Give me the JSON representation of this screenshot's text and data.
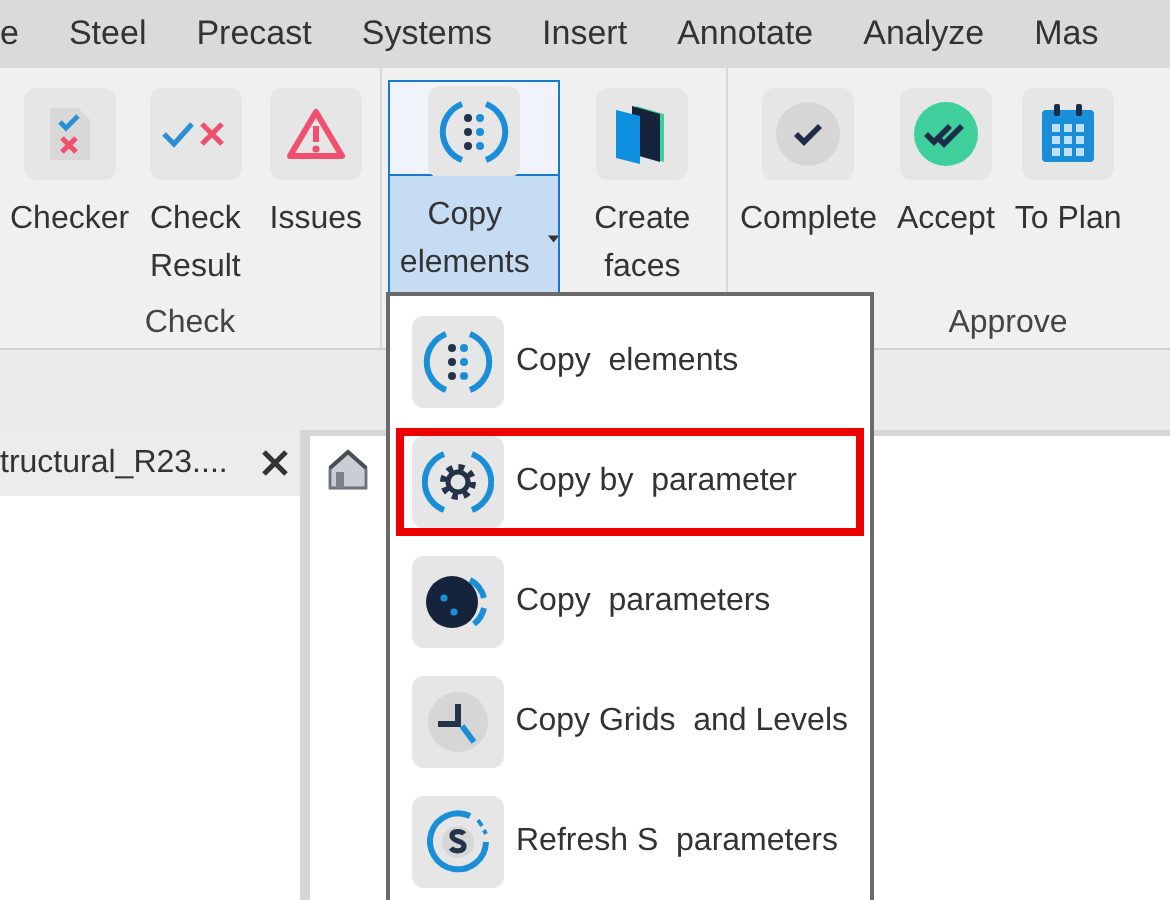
{
  "menu_tabs": [
    "e",
    "Steel",
    "Precast",
    "Systems",
    "Insert",
    "Annotate",
    "Analyze",
    "Mas"
  ],
  "ribbon": {
    "groups": [
      {
        "label": "Check",
        "buttons": [
          {
            "label": "Checker",
            "kind": "checker"
          },
          {
            "label": "Check Result",
            "kind": "check-result"
          },
          {
            "label": "Issues",
            "kind": "issues"
          }
        ]
      },
      {
        "buttons": [
          {
            "label": "Copy elements",
            "kind": "copy-split",
            "expanded": true
          },
          {
            "label": "Create faces",
            "kind": "faces"
          }
        ]
      },
      {
        "label": "Approve",
        "buttons": [
          {
            "label": "Complete",
            "kind": "complete"
          },
          {
            "label": "Accept",
            "kind": "accept"
          },
          {
            "label": "To Plan",
            "kind": "plan"
          }
        ]
      }
    ]
  },
  "panel": {
    "tab_title": "tructural_R23...."
  },
  "dropdown": {
    "items": [
      {
        "label": "Copy  elements",
        "kind": "copy",
        "selected": false
      },
      {
        "label": "Copy by  parameter",
        "kind": "gear",
        "selected": true
      },
      {
        "label": "Copy  parameters",
        "kind": "params",
        "selected": false
      },
      {
        "label": "Copy Grids  and Levels",
        "kind": "grids",
        "selected": false
      },
      {
        "label": "Refresh S  parameters",
        "kind": "refresh",
        "selected": false
      }
    ]
  }
}
